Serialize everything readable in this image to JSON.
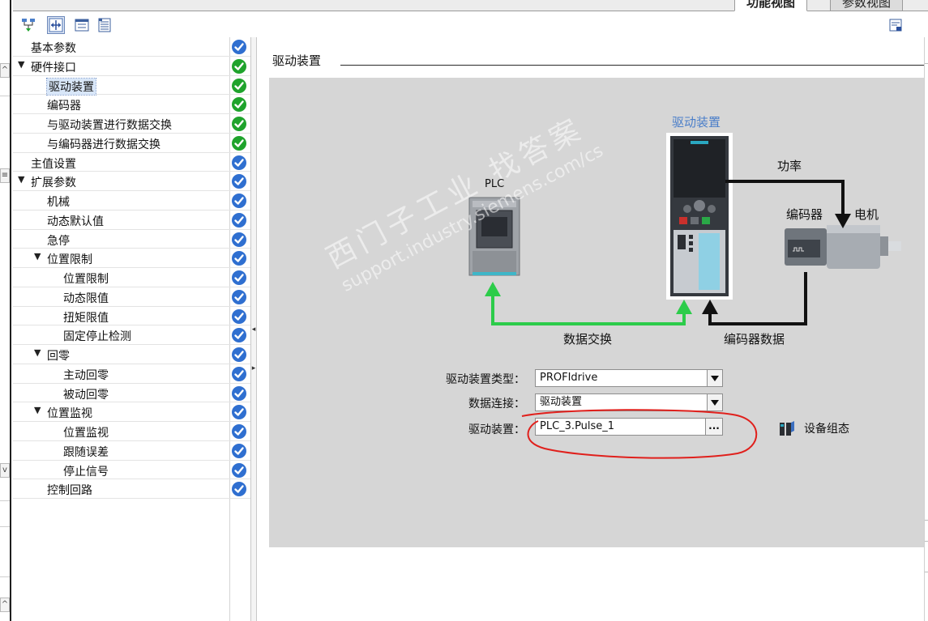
{
  "tabs": [
    {
      "label": "功能视图",
      "active": true
    },
    {
      "label": "参数视图",
      "active": false
    }
  ],
  "toolbar": {
    "buttons": [
      {
        "name": "network-tree-icon"
      },
      {
        "name": "expand-collapse-icon"
      },
      {
        "name": "folder-tree-icon"
      },
      {
        "name": "list-view-icon"
      }
    ],
    "right_button": "save-layout-icon"
  },
  "nav": {
    "items": [
      {
        "label": "基本参数",
        "indent": 0,
        "arrow": "",
        "status": "blue"
      },
      {
        "label": "硬件接口",
        "indent": 0,
        "arrow": "▼",
        "status": "green"
      },
      {
        "label": "驱动装置",
        "indent": 1,
        "arrow": "",
        "status": "green",
        "selected": true
      },
      {
        "label": "编码器",
        "indent": 1,
        "arrow": "",
        "status": "green"
      },
      {
        "label": "与驱动装置进行数据交换",
        "indent": 1,
        "arrow": "",
        "status": "green"
      },
      {
        "label": "与编码器进行数据交换",
        "indent": 1,
        "arrow": "",
        "status": "green"
      },
      {
        "label": "主值设置",
        "indent": 0,
        "arrow": "",
        "status": "blue"
      },
      {
        "label": "扩展参数",
        "indent": 0,
        "arrow": "▼",
        "status": "blue"
      },
      {
        "label": "机械",
        "indent": 1,
        "arrow": "",
        "status": "blue"
      },
      {
        "label": "动态默认值",
        "indent": 1,
        "arrow": "",
        "status": "blue"
      },
      {
        "label": "急停",
        "indent": 1,
        "arrow": "",
        "status": "blue"
      },
      {
        "label": "位置限制",
        "indent": 1,
        "arrow": "▼",
        "status": "blue"
      },
      {
        "label": "位置限制",
        "indent": 2,
        "arrow": "",
        "status": "blue"
      },
      {
        "label": "动态限值",
        "indent": 2,
        "arrow": "",
        "status": "blue"
      },
      {
        "label": "扭矩限值",
        "indent": 2,
        "arrow": "",
        "status": "blue"
      },
      {
        "label": "固定停止检测",
        "indent": 2,
        "arrow": "",
        "status": "blue"
      },
      {
        "label": "回零",
        "indent": 1,
        "arrow": "▼",
        "status": "blue"
      },
      {
        "label": "主动回零",
        "indent": 2,
        "arrow": "",
        "status": "blue"
      },
      {
        "label": "被动回零",
        "indent": 2,
        "arrow": "",
        "status": "blue"
      },
      {
        "label": "位置监视",
        "indent": 1,
        "arrow": "▼",
        "status": "blue"
      },
      {
        "label": "位置监视",
        "indent": 2,
        "arrow": "",
        "status": "blue"
      },
      {
        "label": "跟随误差",
        "indent": 2,
        "arrow": "",
        "status": "blue"
      },
      {
        "label": "停止信号",
        "indent": 2,
        "arrow": "",
        "status": "blue"
      },
      {
        "label": "控制回路",
        "indent": 1,
        "arrow": "",
        "status": "blue"
      }
    ]
  },
  "content": {
    "section_title": "驱动装置",
    "diagram": {
      "plc_label": "PLC",
      "drive_label": "驱动装置",
      "power_label": "功率",
      "encoder_label": "编码器",
      "motor_label": "电机",
      "data_exchange_label": "数据交换",
      "encoder_data_label": "编码器数据"
    },
    "watermark": {
      "line1": "西门子工业  找答案",
      "line2": "support.industry.siemens.com/cs"
    },
    "form": {
      "drive_type_label": "驱动装置类型：",
      "drive_type_value": "PROFIdrive",
      "data_connection_label": "数据连接：",
      "data_connection_value": "驱动装置",
      "drive_label": "驱动装置：",
      "drive_value": "PLC_3.Pulse_1",
      "ellipsis": "...",
      "device_config_label": "设备组态"
    }
  },
  "colors": {
    "status_blue": "#2f6fd0",
    "status_green": "#1fa32c",
    "panel_bg": "#d6d6d6",
    "data_exchange_arrow": "#2ccc4a",
    "annotation_red": "#e0201c",
    "drive_title_blue": "#4a7ec9"
  }
}
